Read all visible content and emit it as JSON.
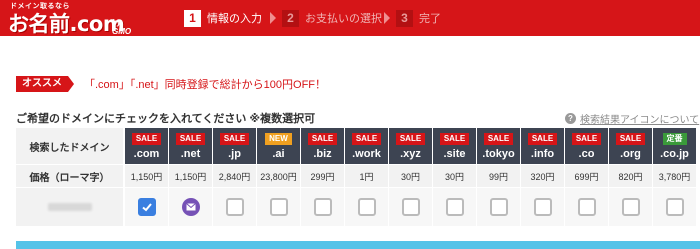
{
  "header": {
    "logo_small": "ドメイン取るなら",
    "logo_main": "お名前.com",
    "logo_sub": "by GMO",
    "steps": [
      {
        "num": "1",
        "label": "情報の入力",
        "active": true
      },
      {
        "num": "2",
        "label": "お支払いの選択",
        "active": false
      },
      {
        "num": "3",
        "label": "完了",
        "active": false
      }
    ]
  },
  "promo": {
    "badge": "オススメ",
    "text": "「.com」「.net」同時登録で総計から100円OFF！"
  },
  "section": {
    "title": "ご希望のドメインにチェックを入れてください ※複数選択可",
    "help_icon": "question-icon",
    "help_text": "検索結果アイコンについて"
  },
  "table": {
    "head_label": "検索したドメイン",
    "price_label": "価格（ローマ字）",
    "domains": [
      {
        "badge": "SALE",
        "badge_color": "#d61518",
        "tld": ".com",
        "price": "1,150円",
        "state": "checked"
      },
      {
        "badge": "SALE",
        "badge_color": "#d61518",
        "tld": ".net",
        "price": "1,150円",
        "state": "mail"
      },
      {
        "badge": "SALE",
        "badge_color": "#d61518",
        "tld": ".jp",
        "price": "2,840円",
        "state": "empty"
      },
      {
        "badge": "NEW",
        "badge_color": "#f0a020",
        "tld": ".ai",
        "price": "23,800円",
        "state": "empty"
      },
      {
        "badge": "SALE",
        "badge_color": "#d61518",
        "tld": ".biz",
        "price": "299円",
        "state": "empty"
      },
      {
        "badge": "SALE",
        "badge_color": "#d61518",
        "tld": ".work",
        "price": "1円",
        "state": "empty"
      },
      {
        "badge": "SALE",
        "badge_color": "#d61518",
        "tld": ".xyz",
        "price": "30円",
        "state": "empty"
      },
      {
        "badge": "SALE",
        "badge_color": "#d61518",
        "tld": ".site",
        "price": "30円",
        "state": "empty"
      },
      {
        "badge": "SALE",
        "badge_color": "#d61518",
        "tld": ".tokyo",
        "price": "99円",
        "state": "empty"
      },
      {
        "badge": "SALE",
        "badge_color": "#d61518",
        "tld": ".info",
        "price": "320円",
        "state": "empty"
      },
      {
        "badge": "SALE",
        "badge_color": "#d61518",
        "tld": ".co",
        "price": "699円",
        "state": "empty"
      },
      {
        "badge": "SALE",
        "badge_color": "#d61518",
        "tld": ".org",
        "price": "820円",
        "state": "empty"
      },
      {
        "badge": "定番",
        "badge_color": "#3a9a3a",
        "tld": ".co.jp",
        "price": "3,780円",
        "state": "empty"
      }
    ]
  },
  "colors": {
    "brand_red": "#d61518",
    "header_cell": "#3d4452",
    "check_blue": "#3a7fe0",
    "mail_purple": "#7652b6",
    "bottom_bar": "#55c3e8"
  }
}
